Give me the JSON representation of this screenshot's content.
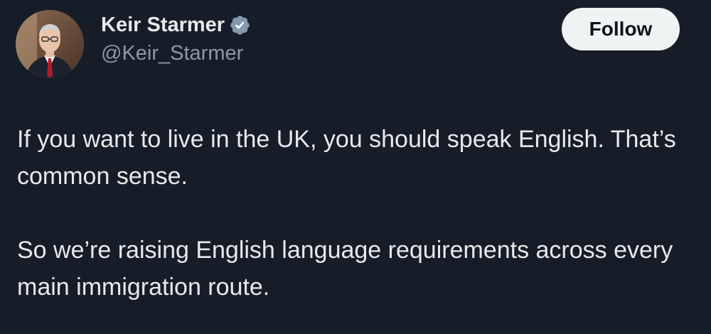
{
  "author": {
    "display_name": "Keir Starmer",
    "handle": "@Keir_Starmer",
    "verified_icon": "verified-badge-icon",
    "avatar": "profile-photo"
  },
  "actions": {
    "follow_label": "Follow"
  },
  "tweet": {
    "paragraphs": [
      "If you want to live in the UK, you should speak English. That’s common sense.",
      "So we’re raising English language requirements across every main immigration route."
    ]
  },
  "colors": {
    "background": "#161d29",
    "text_primary": "#e7e9ea",
    "text_secondary": "#8b98a5",
    "button_bg": "#eff3f4",
    "button_text": "#0f1419",
    "badge": "#829aab"
  }
}
